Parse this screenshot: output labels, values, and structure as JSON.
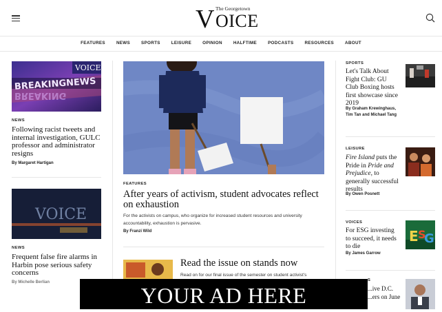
{
  "header": {
    "logo_the": "The Georgetown",
    "logo_v": "V",
    "logo_oice": "OICE"
  },
  "nav": [
    "FEATURES",
    "NEWS",
    "SPORTS",
    "LEISURE",
    "OPINION",
    "HALFTIME",
    "PODCASTS",
    "RESOURCES",
    "ABOUT"
  ],
  "left": [
    {
      "kicker": "NEWS",
      "headline": "Following racist tweets and internal investigation, GULC professor and administrator resigns",
      "byline": "By Margaret Hartigan"
    },
    {
      "kicker": "NEWS",
      "headline": "Frequent false fire alarms in Harbin pose serious safety concerns",
      "byline": "By Michelle Berlian"
    }
  ],
  "main": {
    "kicker": "FEATURES",
    "headline": "After years of activism, student advocates reflect on exhaustion",
    "dek": "For the activists on campus, who organize for increased student resources and university accountability, exhaustion is pervasive.",
    "byline": "By Franzi Wild",
    "issue_title": "Read the issue on stands now",
    "issue_text": "Read on for our final issue of the semester on student activist's"
  },
  "right": [
    {
      "kicker": "SPORTS",
      "headline": "Let's Talk About Fight Club: GU Club Boxing hosts first showcase since 2019",
      "byline": "By Graham Krewinghaus, Tim Tan and Michael Tang"
    },
    {
      "kicker": "LEISURE",
      "headline_italic": "Fire Island",
      "headline_a": " puts the Pride in ",
      "headline_italic2": "Pride and Prejudice",
      "headline_b": ", to generally successful results",
      "byline": "By Owen Posnett"
    },
    {
      "kicker": "VOICES",
      "headline": "For ESG investing to succeed, it needs to die",
      "byline": "By James Garrow"
    },
    {
      "kicker": "S",
      "headline": "...ive D.C. ...ers on June"
    }
  ],
  "ad": {
    "text": "YOUR AD HERE"
  },
  "thumb_texts": {
    "breaking": "BREAKINGNEWS",
    "voice": "VOICE"
  }
}
